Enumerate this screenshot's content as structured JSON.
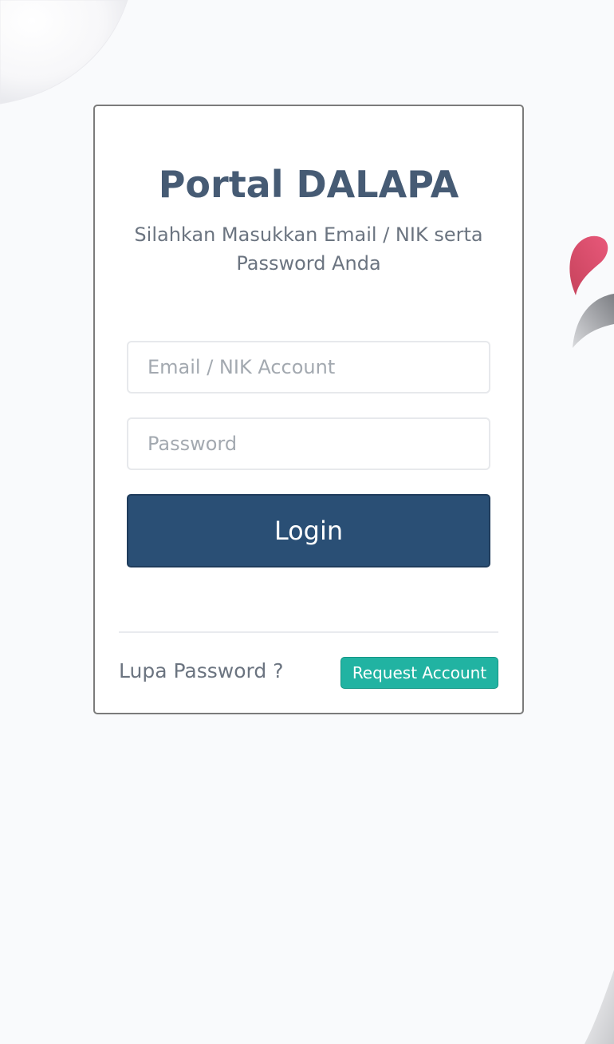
{
  "login": {
    "title": "Portal DALAPA",
    "subtitle": "Silahkan Masukkan Email / NIK serta Password Anda",
    "email_placeholder": "Email / NIK Account",
    "email_value": "",
    "password_placeholder": "Password",
    "password_value": "",
    "login_label": "Login",
    "forgot_label": "Lupa Password ?",
    "request_label": "Request Account"
  },
  "colors": {
    "background": "#f9fafc",
    "title": "#465b74",
    "primary_button": "#2a4f75",
    "secondary_button": "#21b3a2",
    "decoration_red": "#d84c68",
    "decoration_gray": "#9ea0a4"
  }
}
